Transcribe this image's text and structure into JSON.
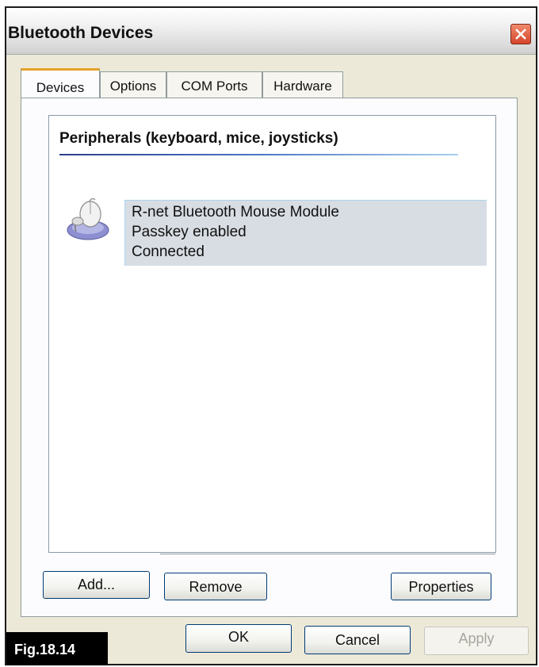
{
  "window": {
    "title": "Bluetooth Devices"
  },
  "tabs": [
    {
      "label": "Devices",
      "active": true
    },
    {
      "label": "Options",
      "active": false
    },
    {
      "label": "COM Ports",
      "active": false
    },
    {
      "label": "Hardware",
      "active": false
    }
  ],
  "devices_panel": {
    "group_heading": "Peripherals (keyboard, mice, joysticks)",
    "device": {
      "icon": "bluetooth-mouse-icon",
      "name": "R-net Bluetooth Mouse Module",
      "passkey": "Passkey enabled",
      "status": "Connected"
    }
  },
  "panel_buttons": {
    "add": "Add...",
    "remove": "Remove",
    "properties": "Properties"
  },
  "dialog_buttons": {
    "ok": "OK",
    "cancel": "Cancel",
    "apply": "Apply",
    "apply_enabled": false
  },
  "figure_label": "Fig.18.14"
}
